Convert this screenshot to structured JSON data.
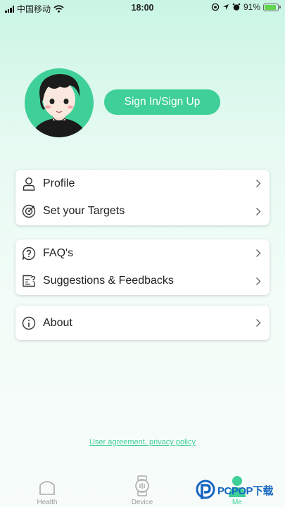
{
  "status_bar": {
    "carrier": "中国移动",
    "time": "18:00",
    "battery_percent": "91%",
    "battery_level": 0.91,
    "icons": [
      "signal-icon",
      "wifi-icon",
      "rotation-lock-icon",
      "location-icon",
      "alarm-icon",
      "battery-icon"
    ]
  },
  "header": {
    "avatar": "avatar-illustration",
    "signin_label": "Sign In/Sign Up"
  },
  "menu_groups": [
    [
      {
        "label": "Profile",
        "icon": "user-icon"
      },
      {
        "label": "Set your Targets",
        "icon": "target-icon"
      }
    ],
    [
      {
        "label": "FAQ's",
        "icon": "question-icon"
      },
      {
        "label": "Suggestions & Feedbacks",
        "icon": "feedback-icon"
      }
    ],
    [
      {
        "label": "About",
        "icon": "info-icon"
      }
    ]
  ],
  "footer_link": "User agreement, privacy policy",
  "tabs": [
    {
      "label": "Health",
      "icon": "home-icon",
      "active": false
    },
    {
      "label": "Device",
      "icon": "watch-icon",
      "active": false
    },
    {
      "label": "Me",
      "icon": "me-icon",
      "active": true
    }
  ],
  "watermark": {
    "text": "PCPOP下载"
  },
  "colors": {
    "accent": "#3fcf98",
    "text": "#1f1f1f",
    "inactive_tab": "#999999",
    "watermark": "#1565c0"
  }
}
